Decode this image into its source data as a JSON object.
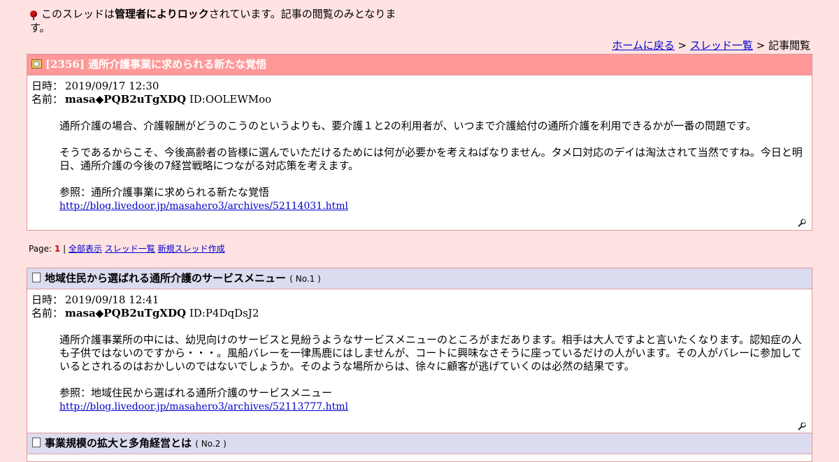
{
  "lock_notice": {
    "prefix": "このスレッドは",
    "emphasis": "管理者によりロック",
    "suffix": "されています。記事の閲覧のみとなります。"
  },
  "nav": {
    "home": "ホームに戻る",
    "sep1": " > ",
    "thread_list": "スレッド一覧",
    "sep2": " > ",
    "current": "記事閲覧"
  },
  "thread": {
    "title": "[2356] 通所介護事業に求められる新たな覚悟",
    "date_label": "日時：",
    "date": "2019/09/17 12:30",
    "name_label": "名前：",
    "name": "masa◆PQB2uTgXDQ",
    "id": "ID:OOLEWMoo",
    "paragraphs": [
      "通所介護の場合、介護報酬がどうのこうのというよりも、要介護１と2の利用者が、いつまで介護給付の通所介護を利用できるかが一番の問題です。",
      "そうであるからこそ、今後高齢者の皆様に選んでいただけるためには何が必要かを考えねばなりません。タメ口対応のデイは淘汰されて当然ですね。今日と明日、通所介護の今後の7経営戦略につながる対応策を考えます。"
    ],
    "ref_label": "参照：通所介護事業に求められる新たな覚悟",
    "ref_url": "http://blog.livedoor.jp/masahero3/archives/52114031.html"
  },
  "pager": {
    "label": "Page: ",
    "current": "1",
    "sep": " | ",
    "show_all": "全部表示",
    "thread_list": "スレッド一覧",
    "new_thread": "新規スレッド作成"
  },
  "reply1": {
    "title": "地域住民から選ばれる通所介護のサービスメニュー",
    "no": "( No.1 )",
    "date_label": "日時：",
    "date": "2019/09/18 12:41",
    "name_label": "名前：",
    "name": "masa◆PQB2uTgXDQ",
    "id": "ID:P4DqDsJ2",
    "paragraphs": [
      "通所介護事業所の中には、幼児向けのサービスと見紛うようなサービスメニューのところがまだあります。相手は大人ですよと言いたくなります。認知症の人も子供ではないのですから・・・。風船バレーを一律馬鹿にはしませんが、コートに興味なさそうに座っているだけの人がいます。その人がバレーに参加しているとされるのはおかしいのではないでしょうか。そのような場所からは、徐々に顧客が逃げていくのは必然の結果です。"
    ],
    "ref_label": "参照：地域住民から選ばれる通所介護のサービスメニュー",
    "ref_url": "http://blog.livedoor.jp/masahero3/archives/52113777.html"
  },
  "reply2": {
    "title": "事業規模の拡大と多角経営とは",
    "no": "( No.2 )"
  }
}
